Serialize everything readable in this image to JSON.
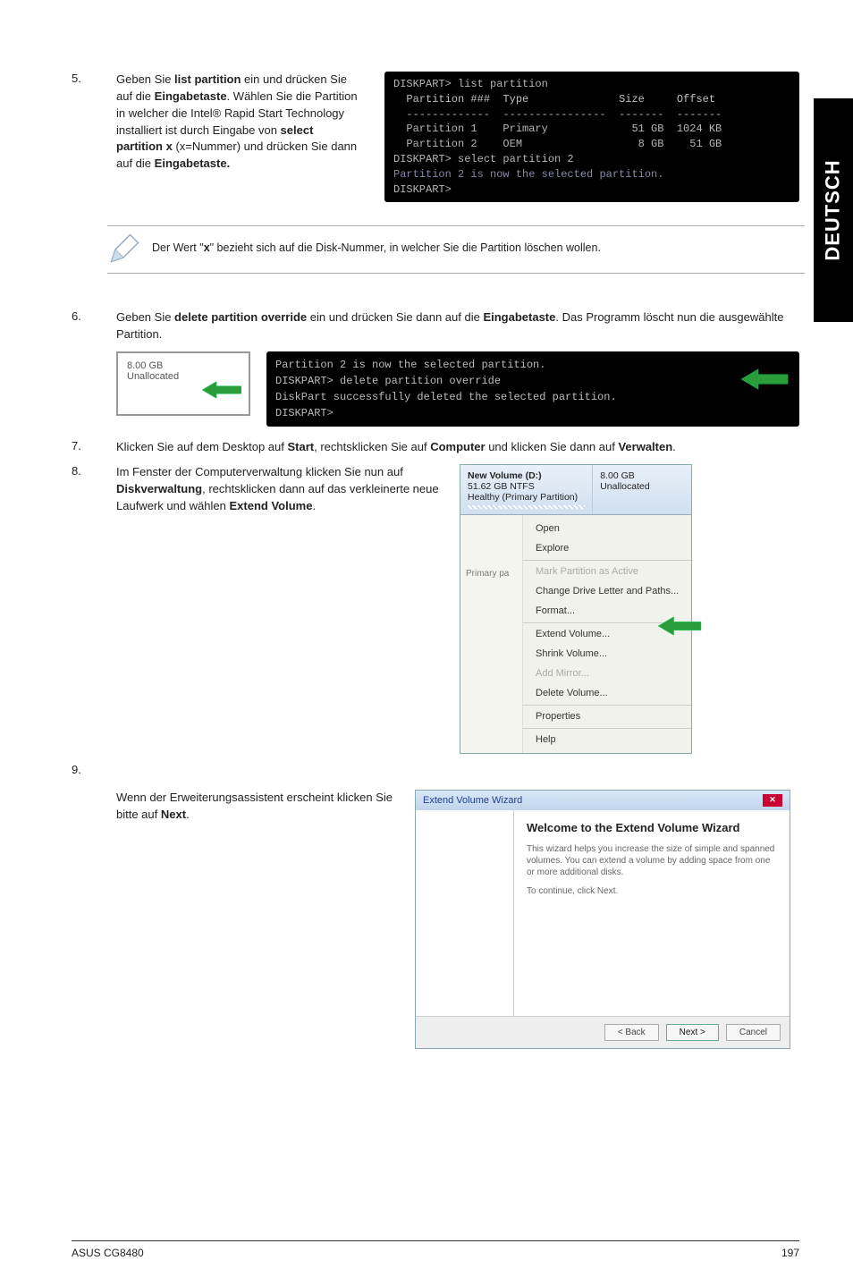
{
  "side_tab": "DEUTSCH",
  "step5": {
    "num": "5.",
    "text_parts": [
      "Geben Sie ",
      " ein und drücken Sie auf die ",
      ". Wählen Sie die Partition in welcher die Intel® Rapid Start Technology installiert ist durch Eingabe von ",
      " (x=Nummer) und drücken Sie dann auf die "
    ],
    "b1": "list partition",
    "b2": "Eingabetaste",
    "b3": "select partition x",
    "b4": "Eingabetaste."
  },
  "term1": {
    "l1": "DISKPART> list partition",
    "hdr": "  Partition ###  Type              Size     Offset",
    "sep": "  -------------  ----------------  -------  -------",
    "r1": "  Partition 1    Primary             51 GB  1024 KB",
    "r2": "  Partition 2    OEM                  8 GB    51 GB",
    "l2": "DISKPART> select partition 2",
    "l3": "Partition 2 is now the selected partition.",
    "l4": "DISKPART>"
  },
  "note": "Der Wert \"x\" bezieht sich auf die Disk-Nummer, in welcher Sie die Partition löschen wollen.",
  "step6": {
    "num": "6.",
    "text_a": "Geben Sie ",
    "b1": "delete partition override",
    "text_b": " ein und drücken Sie dann auf die ",
    "b2": "Eingabetaste",
    "text_c": ". Das Programm löscht nun die ausgewählte Partition."
  },
  "dm_left": {
    "size": "8.00 GB",
    "state": "Unallocated"
  },
  "term2": {
    "l1": "Partition 2 is now the selected partition.",
    "l2": "DISKPART> delete partition override",
    "l3": "DiskPart successfully deleted the selected partition.",
    "l4": "DISKPART>"
  },
  "step7": {
    "num": "7.",
    "a": "Klicken Sie auf dem Desktop auf ",
    "b1": "Start",
    "b": ", rechtsklicken Sie auf ",
    "b2": "Computer",
    "c": " und klicken Sie dann auf ",
    "b3": "Verwalten",
    "d": "."
  },
  "step8": {
    "num": "8.",
    "a": "Im Fenster der Computerverwaltung klicken Sie nun auf ",
    "b1": "Diskverwaltung",
    "b": ", rechtsklicken dann auf das verkleinerte neue Laufwerk und wählen ",
    "b2": "Extend Volume",
    "c": "."
  },
  "ctx": {
    "vol_title": "New Volume  (D:)",
    "vol_sub1": "51.62 GB NTFS",
    "vol_sub2": "Healthy (Primary Partition)",
    "unalloc_size": "8.00 GB",
    "unalloc_state": "Unallocated",
    "left_label": "Primary pa",
    "items": [
      "Open",
      "Explore",
      "Mark Partition as Active",
      "Change Drive Letter and Paths...",
      "Format...",
      "Extend Volume...",
      "Shrink Volume...",
      "Add Mirror...",
      "Delete Volume...",
      "Properties",
      "Help"
    ]
  },
  "step9": {
    "num": "9.",
    "a": "Wenn der Erweiterungsassistent erscheint klicken Sie bitte auf ",
    "b1": "Next",
    "b": "."
  },
  "wizard": {
    "title": "Extend Volume Wizard",
    "heading": "Welcome to the Extend Volume Wizard",
    "p1": "This wizard helps you increase the size of simple and spanned volumes. You can extend a volume by adding space from one or more additional disks.",
    "p2": "To continue, click Next.",
    "btn_back": "< Back",
    "btn_next": "Next >",
    "btn_cancel": "Cancel"
  },
  "footer": {
    "left": "ASUS CG8480",
    "right": "197"
  }
}
